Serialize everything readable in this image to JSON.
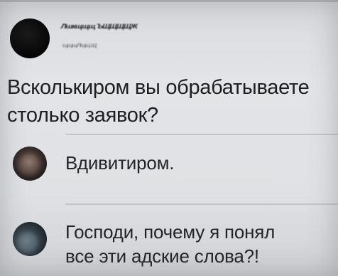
{
  "post": {
    "author_name": "Лшкщщщ ЪЩЩЩЩЖ",
    "timestamp": "щщщЛщщ Щ",
    "text_line1": "Всколькиром вы обрабатываете",
    "text_line2": "столько заявок?"
  },
  "comments": [
    {
      "text": "Вдивитиром."
    },
    {
      "text_line1": "Господи, почему я понял",
      "text_line2": "все эти адские слова?!"
    }
  ],
  "colors": {
    "background": "#e0e2e5",
    "text": "#1e1e20",
    "divider": "#c3c5c8"
  }
}
